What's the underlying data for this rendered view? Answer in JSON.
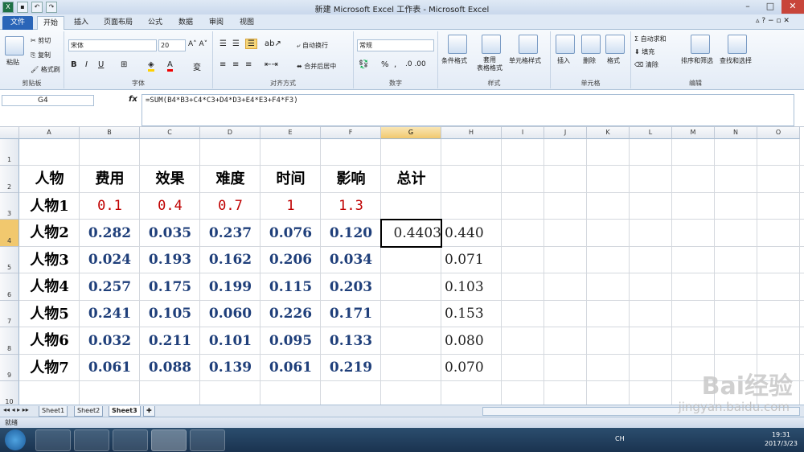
{
  "window": {
    "title": "新建 Microsoft Excel 工作表 - Microsoft Excel"
  },
  "tabs": [
    "文件",
    "开始",
    "插入",
    "页面布局",
    "公式",
    "数据",
    "审阅",
    "视图"
  ],
  "ribbon": {
    "clipboard": {
      "label": "剪贴板",
      "paste": "粘贴",
      "cut": "剪切",
      "copy": "复制",
      "format_painter": "格式刷"
    },
    "font": {
      "label": "字体",
      "name": "宋体",
      "size": "20",
      "bold": "B",
      "italic": "I",
      "underline": "U"
    },
    "alignment": {
      "label": "对齐方式",
      "wrap": "自动换行",
      "merge": "合并后居中"
    },
    "number": {
      "label": "数字",
      "format": "常规",
      "percent": "%",
      "comma": ","
    },
    "styles": {
      "label": "样式",
      "conditional": "条件格式",
      "table": "套用\n表格格式",
      "cell_styles": "单元格样式"
    },
    "cells": {
      "label": "单元格",
      "insert": "插入",
      "delete": "删除",
      "format": "格式"
    },
    "editing": {
      "label": "编辑",
      "autosum": "自动求和",
      "fill": "填充",
      "clear": "清除",
      "sort": "排序和筛选",
      "find": "查找和选择"
    }
  },
  "formula_bar": {
    "name_box": "G4",
    "fx": "fx",
    "formula": "=SUM(B4*B3+C4*C3+D4*D3+E4*E3+F4*F3)"
  },
  "columns": [
    "A",
    "B",
    "C",
    "D",
    "E",
    "F",
    "G",
    "H",
    "I",
    "J",
    "K",
    "L",
    "M",
    "N",
    "O"
  ],
  "rows": [
    "1",
    "2",
    "3",
    "4",
    "5",
    "6",
    "7",
    "8",
    "9",
    "10"
  ],
  "table": {
    "header": [
      "人物",
      "费用",
      "效果",
      "难度",
      "时间",
      "影响",
      "总计"
    ],
    "weights": {
      "label": "人物1",
      "values": [
        "0.1",
        "0.4",
        "0.7",
        "1",
        "1.3"
      ]
    },
    "people": [
      {
        "name": "人物2",
        "values": [
          "0.282",
          "0.035",
          "0.237",
          "0.076",
          "0.120"
        ],
        "g": "0.4403",
        "h": "0.440"
      },
      {
        "name": "人物3",
        "values": [
          "0.024",
          "0.193",
          "0.162",
          "0.206",
          "0.034"
        ],
        "g": "",
        "h": "0.071"
      },
      {
        "name": "人物4",
        "values": [
          "0.257",
          "0.175",
          "0.199",
          "0.115",
          "0.203"
        ],
        "g": "",
        "h": "0.103"
      },
      {
        "name": "人物5",
        "values": [
          "0.241",
          "0.105",
          "0.060",
          "0.226",
          "0.171"
        ],
        "g": "",
        "h": "0.153"
      },
      {
        "name": "人物6",
        "values": [
          "0.032",
          "0.211",
          "0.101",
          "0.095",
          "0.133"
        ],
        "g": "",
        "h": "0.080"
      },
      {
        "name": "人物7",
        "values": [
          "0.061",
          "0.088",
          "0.139",
          "0.061",
          "0.219"
        ],
        "g": "",
        "h": "0.070"
      }
    ]
  },
  "sheets": [
    "Sheet1",
    "Sheet2",
    "Sheet3"
  ],
  "active_sheet": "Sheet3",
  "status": {
    "text": "就绪"
  },
  "taskbar": {
    "time": "19:31",
    "date": "2017/3/23",
    "lang": "CH"
  },
  "watermark": {
    "brand": "Bai经验",
    "url": "jingyan.baidu.com"
  },
  "colors": {
    "accent": "#2a65b8",
    "red_values": "#c00000",
    "blue_values": "#1f3f7a",
    "selection_header": "#f1c86e"
  }
}
